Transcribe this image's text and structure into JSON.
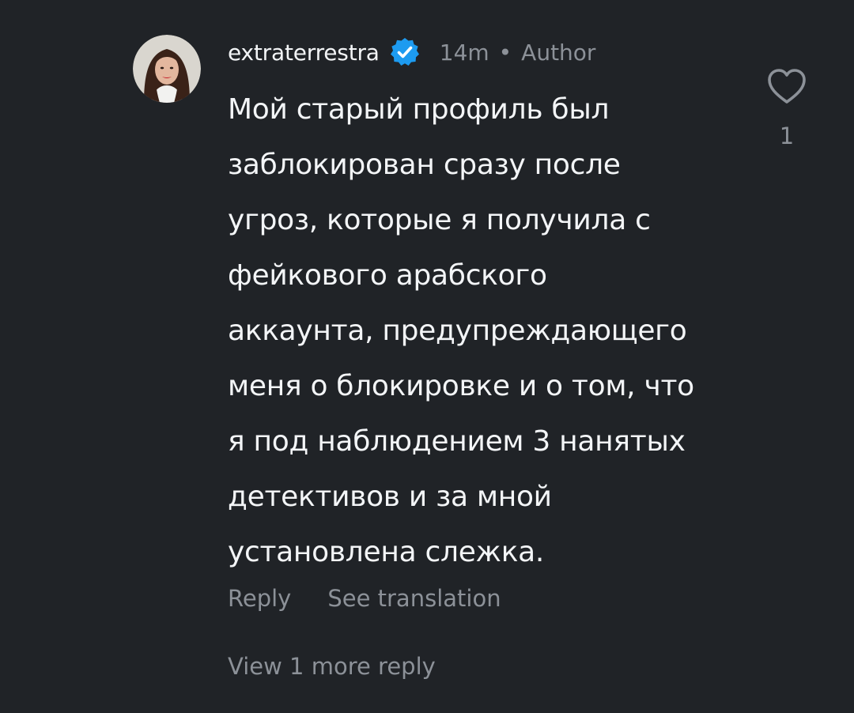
{
  "comment": {
    "username": "extraterrestra",
    "verified_icon": "verified-badge-icon",
    "verified_color": "#1d9bf0",
    "time": "14m",
    "separator": "•",
    "role": "Author",
    "text": "Мой старый профиль был\nзаблокирован сразу после\nугроз, которые я получила с\nфейкового арабского\nаккаунта, предупреждающего\nменя о блокировке и о том, что\nя под наблюдением 3 нанятых\nдетективов и за мной\nустановлена слежка.",
    "like_icon": "heart-icon",
    "like_count": "1"
  },
  "actions": {
    "reply": "Reply",
    "see_translation": "See translation"
  },
  "replies": {
    "view_more": "View 1 more reply"
  },
  "colors": {
    "background": "#202327",
    "primary_text": "#f3f5f7",
    "secondary_text": "#8c9198"
  }
}
